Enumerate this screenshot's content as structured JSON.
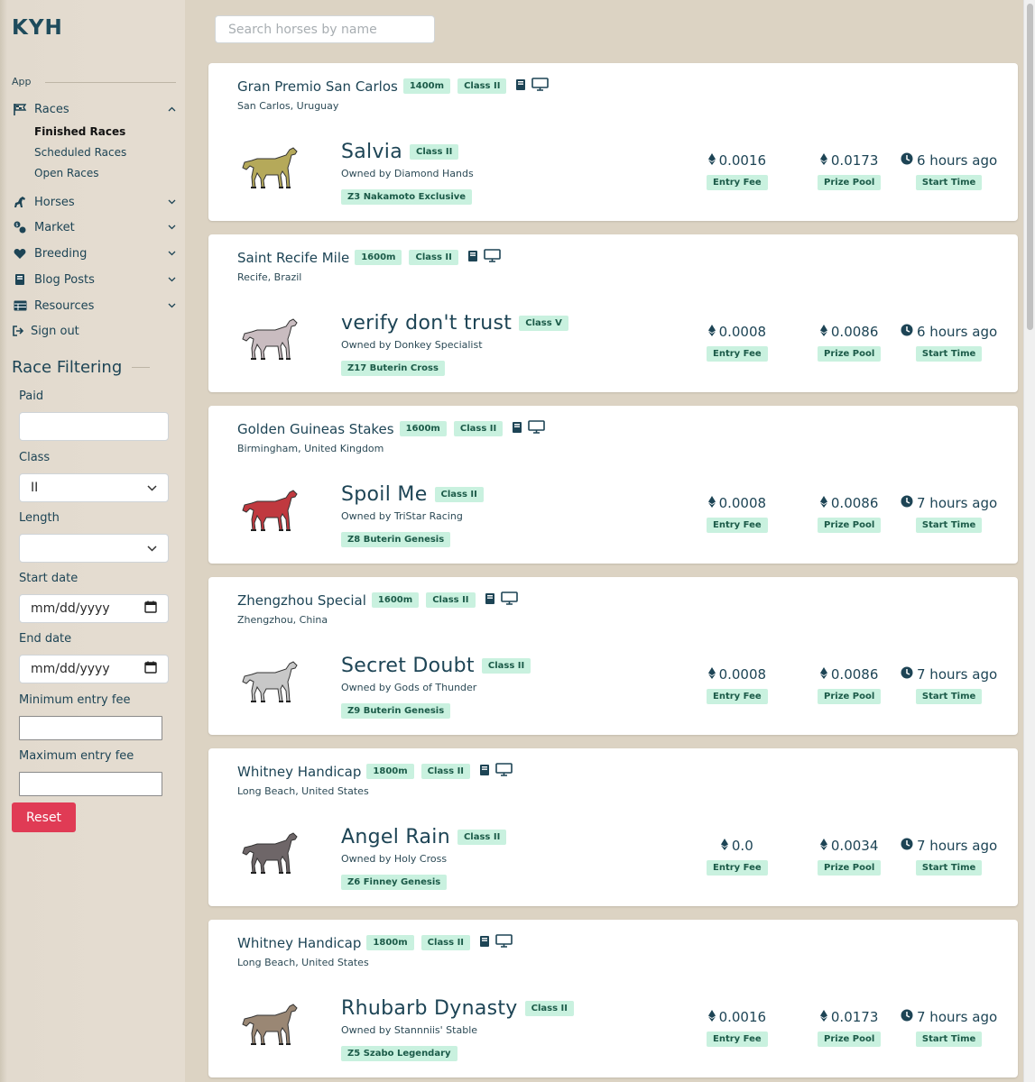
{
  "app": {
    "logo": "KYH"
  },
  "sidebar": {
    "section_label": "App",
    "nav": [
      {
        "label": "Races",
        "icon": "flag-icon",
        "expanded": true
      },
      {
        "label": "Horses",
        "icon": "horse-icon"
      },
      {
        "label": "Market",
        "icon": "market-icon"
      },
      {
        "label": "Breeding",
        "icon": "heart-icon"
      },
      {
        "label": "Blog Posts",
        "icon": "book-icon"
      },
      {
        "label": "Resources",
        "icon": "table-icon"
      },
      {
        "label": "Sign out",
        "icon": "sign-out-icon"
      }
    ],
    "races_sub": [
      "Finished Races",
      "Scheduled Races",
      "Open Races"
    ],
    "active_sub": "Finished Races"
  },
  "filter": {
    "title": "Race Filtering",
    "paid_label": "Paid",
    "paid_value": "",
    "class_label": "Class",
    "class_value": "II",
    "length_label": "Length",
    "length_value": "",
    "start_label": "Start date",
    "start_placeholder": "mm/dd/yyyy",
    "end_label": "End date",
    "end_placeholder": "mm/dd/yyyy",
    "min_fee_label": "Minimum entry fee",
    "max_fee_label": "Maximum entry fee",
    "reset_label": "Reset"
  },
  "search": {
    "placeholder": "Search horses by name"
  },
  "stat_labels": {
    "entry_fee": "Entry Fee",
    "prize_pool": "Prize Pool",
    "start_time": "Start Time"
  },
  "races": [
    {
      "name": "Gran Premio San Carlos",
      "length": "1400m",
      "class": "Class II",
      "location": "San Carlos, Uruguay",
      "horse": {
        "name": "Salvia",
        "class": "Class II",
        "owner": "Owned by Diamond Hands",
        "breed": "Z3 Nakamoto Exclusive",
        "color": "#b5a95a"
      },
      "entry_fee": "0.0016",
      "prize_pool": "0.0173",
      "start_time": "6 hours ago"
    },
    {
      "name": "Saint Recife Mile",
      "length": "1600m",
      "class": "Class II",
      "location": "Recife, Brazil",
      "horse": {
        "name": "verify don't trust",
        "class": "Class V",
        "owner": "Owned by Donkey Specialist",
        "breed": "Z17 Buterin Cross",
        "color": "#c9bcc0"
      },
      "entry_fee": "0.0008",
      "prize_pool": "0.0086",
      "start_time": "6 hours ago"
    },
    {
      "name": "Golden Guineas Stakes",
      "length": "1600m",
      "class": "Class II",
      "location": "Birmingham, United Kingdom",
      "horse": {
        "name": "Spoil Me",
        "class": "Class II",
        "owner": "Owned by TriStar Racing",
        "breed": "Z8 Buterin Genesis",
        "color": "#c0393f"
      },
      "entry_fee": "0.0008",
      "prize_pool": "0.0086",
      "start_time": "7 hours ago"
    },
    {
      "name": "Zhengzhou Special",
      "length": "1600m",
      "class": "Class II",
      "location": "Zhengzhou, China",
      "horse": {
        "name": "Secret Doubt",
        "class": "Class II",
        "owner": "Owned by Gods of Thunder",
        "breed": "Z9 Buterin Genesis",
        "color": "#c8c8c8"
      },
      "entry_fee": "0.0008",
      "prize_pool": "0.0086",
      "start_time": "7 hours ago"
    },
    {
      "name": "Whitney Handicap",
      "length": "1800m",
      "class": "Class II",
      "location": "Long Beach, United States",
      "horse": {
        "name": "Angel Rain",
        "class": "Class II",
        "owner": "Owned by Holy Cross",
        "breed": "Z6 Finney Genesis",
        "color": "#6e6668"
      },
      "entry_fee": "0.0",
      "prize_pool": "0.0034",
      "start_time": "7 hours ago"
    },
    {
      "name": "Whitney Handicap",
      "length": "1800m",
      "class": "Class II",
      "location": "Long Beach, United States",
      "horse": {
        "name": "Rhubarb Dynasty",
        "class": "Class II",
        "owner": "Owned by Stannniis' Stable",
        "breed": "Z5 Szabo Legendary",
        "color": "#9a8774"
      },
      "entry_fee": "0.0016",
      "prize_pool": "0.0173",
      "start_time": "7 hours ago"
    }
  ]
}
